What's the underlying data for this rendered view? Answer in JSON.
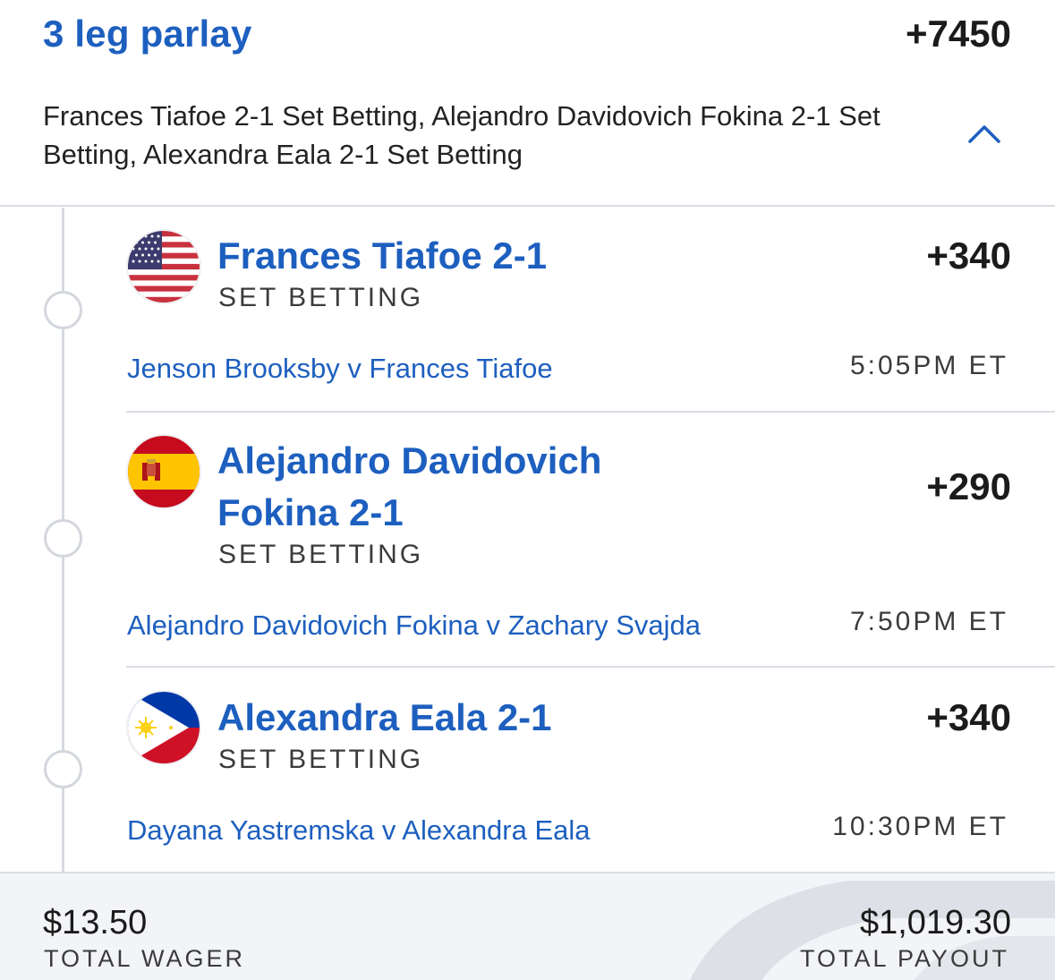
{
  "header": {
    "title": "3 leg parlay",
    "total_odds": "+7450",
    "summary": "Frances Tiafoe 2-1 Set Betting, Alejandro Davidovich Fokina 2-1 Set Betting, Alexandra Eala 2-1 Set Betting",
    "toggle_icon": "chevron-up-icon"
  },
  "legs": [
    {
      "flag_icon": "usa-flag-icon",
      "name_line1": "Frances Tiafoe 2-1",
      "name_line2": "",
      "market": "SET BETTING",
      "odds": "+340",
      "event": "Jenson Brooksby v Frances Tiafoe",
      "time": "5:05PM ET"
    },
    {
      "flag_icon": "spain-flag-icon",
      "name_line1": "Alejandro Davidovich",
      "name_line2": "Fokina 2-1",
      "market": "SET BETTING",
      "odds": "+290",
      "event": "Alejandro Davidovich Fokina v Zachary Svajda",
      "time": "7:50PM ET"
    },
    {
      "flag_icon": "philippines-flag-icon",
      "name_line1": "Alexandra Eala 2-1",
      "name_line2": "",
      "market": "SET BETTING",
      "odds": "+340",
      "event": "Dayana Yastremska v Alexandra Eala",
      "time": "10:30PM ET"
    }
  ],
  "footer": {
    "wager_amount": "$13.50",
    "wager_label": "TOTAL WAGER",
    "payout_amount": "$1,019.30",
    "payout_label": "TOTAL PAYOUT"
  },
  "colors": {
    "accent": "#1d5fbf",
    "text": "#1b1b1b",
    "muted": "#3b3b3b",
    "divider": "#d9dde3",
    "footer_bg": "#f2f4f7"
  }
}
